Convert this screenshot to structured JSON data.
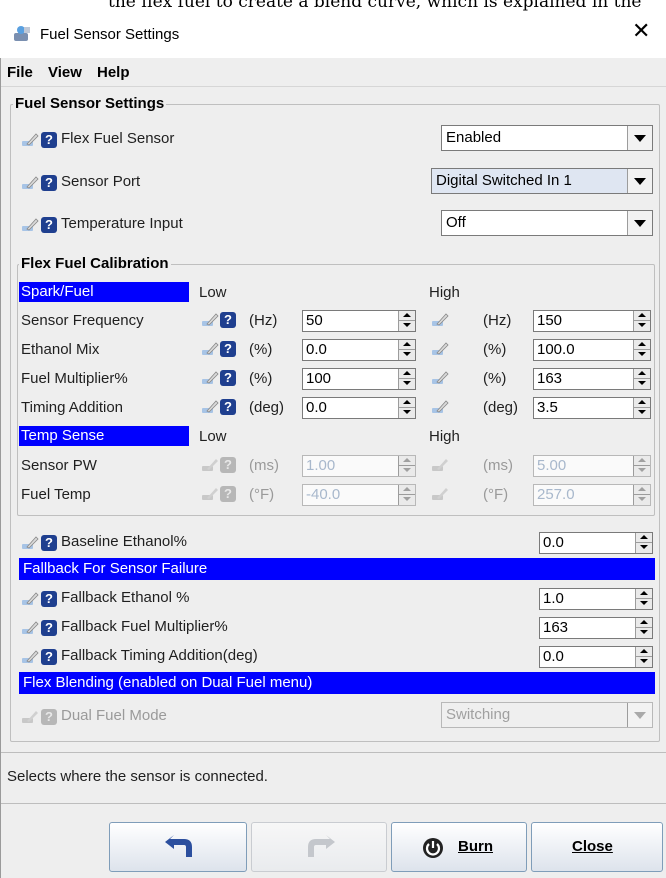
{
  "top_clip_text": "the flex fuel to create a blend curve, which is explained in the",
  "window": {
    "title": "Fuel Sensor Settings",
    "close_glyph": "✕"
  },
  "menu": {
    "file": "File",
    "view": "View",
    "help": "Help"
  },
  "sensor_settings": {
    "group_title": "Fuel Sensor Settings",
    "flex_fuel_sensor": {
      "label": "Flex Fuel Sensor",
      "value": "Enabled"
    },
    "sensor_port": {
      "label": "Sensor Port",
      "value": "Digital Switched In 1"
    },
    "temperature_input": {
      "label": "Temperature Input",
      "value": "Off"
    }
  },
  "calibration": {
    "group_title": "Flex Fuel Calibration",
    "spark_fuel_header": "Spark/Fuel",
    "low": "Low",
    "high": "High",
    "rows": [
      {
        "label": "Sensor Frequency",
        "unit": "(Hz)",
        "low": "50",
        "high": "150"
      },
      {
        "label": "Ethanol Mix",
        "unit": "(%)",
        "low": "0.0",
        "high": "100.0"
      },
      {
        "label": "Fuel Multiplier%",
        "unit": "(%)",
        "low": "100",
        "high": "163"
      },
      {
        "label": "Timing Addition",
        "unit": "(deg)",
        "low": "0.0",
        "high": "3.5"
      }
    ],
    "temp_sense_header": "Temp Sense",
    "temp_low": "Low",
    "temp_high": "High",
    "temp_rows": [
      {
        "label": "Sensor PW",
        "unit": "(ms)",
        "low": "1.00",
        "high": "5.00"
      },
      {
        "label": "Fuel Temp",
        "unit": "(°F)",
        "low": "-40.0",
        "high": "257.0"
      }
    ]
  },
  "baseline": {
    "label": "Baseline Ethanol%",
    "value": "0.0"
  },
  "fallback": {
    "header": "Fallback For Sensor Failure",
    "ethanol": {
      "label": "Fallback Ethanol %",
      "value": "1.0"
    },
    "fuel_multiplier": {
      "label": "Fallback Fuel Multiplier%",
      "value": "163"
    },
    "timing": {
      "label": "Fallback Timing Addition(deg)",
      "value": "0.0"
    }
  },
  "blending": {
    "header": "Flex Blending (enabled on Dual Fuel menu)",
    "dual_fuel_mode": {
      "label": "Dual Fuel Mode",
      "value": "Switching"
    }
  },
  "status_text": "Selects where the sensor is connected.",
  "buttons": {
    "burn": "Burn",
    "close": "Close"
  },
  "icon_glyphs": {
    "help": "?"
  },
  "colors": {
    "header_blue": "#0000ff",
    "help_icon": "#1f3f8f"
  }
}
